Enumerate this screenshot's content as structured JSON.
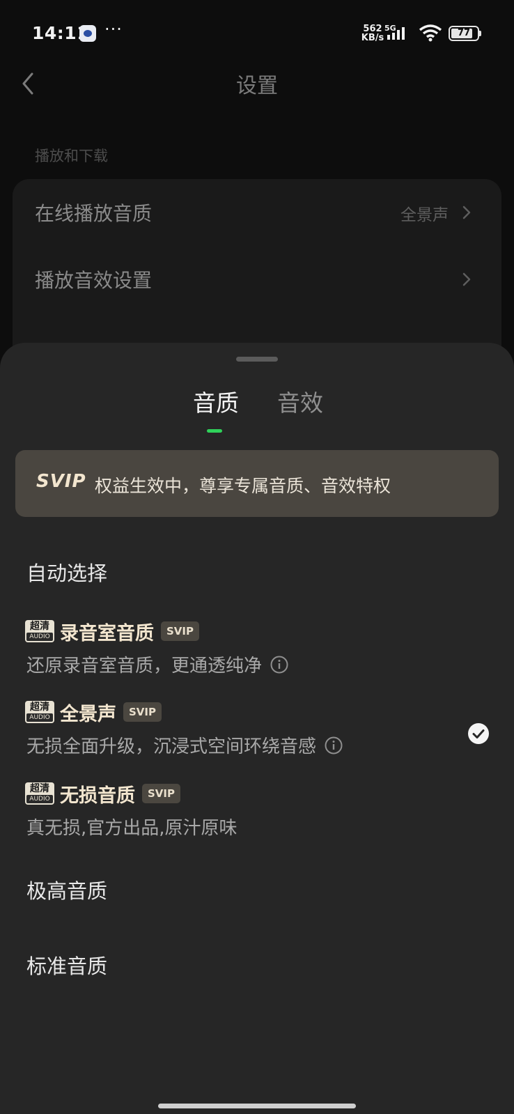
{
  "status_bar": {
    "time": "14:11",
    "more": "···",
    "net_speed_value": "562",
    "net_speed_unit": "KB/s",
    "network": "5G",
    "battery": "77"
  },
  "background_page": {
    "title": "设置",
    "section": "播放和下载",
    "rows": [
      {
        "label": "在线播放音质",
        "value": "全景声"
      },
      {
        "label": "播放音效设置",
        "value": ""
      }
    ]
  },
  "sheet": {
    "tabs": [
      {
        "label": "音质",
        "active": true
      },
      {
        "label": "音效",
        "active": false
      }
    ],
    "banner": {
      "badge": "SVIP",
      "text": "权益生效中，尊享专属音质、音效特权"
    },
    "hd_badge_top": "超清",
    "hd_badge_bottom": "AUDIO",
    "options": [
      {
        "title": "自动选择"
      },
      {
        "title": "录音室音质",
        "tag": "SVIP",
        "desc": "还原录音室音质，更通透纯净"
      },
      {
        "title": "全景声",
        "tag": "SVIP",
        "desc": "无损全面升级，沉浸式空间环绕音感",
        "selected": true
      },
      {
        "title": "无损音质",
        "tag": "SVIP",
        "desc": "真无损,官方出品,原汁原味"
      },
      {
        "title": "极高音质"
      },
      {
        "title": "标准音质"
      }
    ]
  },
  "colors": {
    "accent": "#2fd15a",
    "gold": "#f3e6cf",
    "sheet_bg": "#262626"
  }
}
